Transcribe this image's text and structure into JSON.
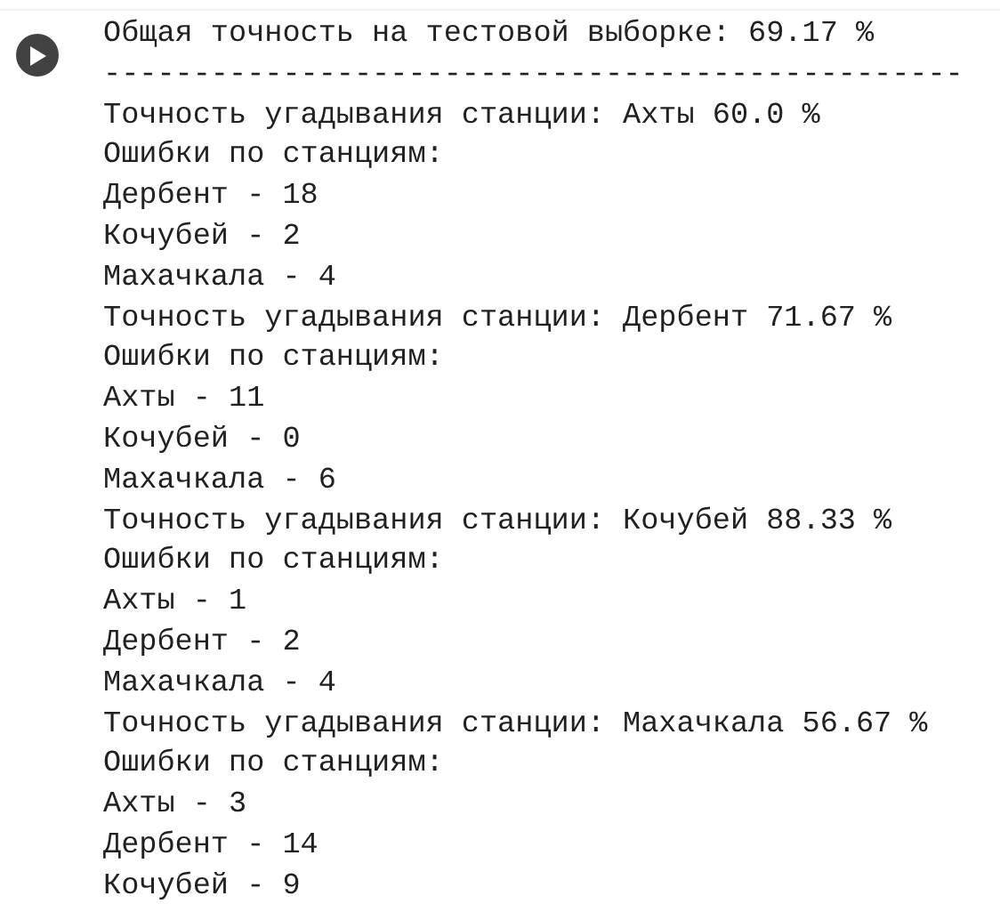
{
  "cell": {
    "output_lines": [
      "Общая точность на тестовой выборке: 69.17 %",
      "------------------------------------------------",
      "Точность угадывания станции: Ахты 60.0 %",
      "Ошибки по станциям:",
      "Дербент - 18",
      "Кочубей - 2",
      "Махачкала - 4",
      "Точность угадывания станции: Дербент 71.67 %",
      "Ошибки по станциям:",
      "Ахты - 11",
      "Кочубей - 0",
      "Махачкала - 6",
      "Точность угадывания станции: Кочубей 88.33 %",
      "Ошибки по станциям:",
      "Ахты - 1",
      "Дербент - 2",
      "Махачкала - 4",
      "Точность угадывания станции: Махачкала 56.67 %",
      "Ошибки по станциям:",
      "Ахты - 3",
      "Дербент - 14",
      "Кочубей - 9"
    ]
  }
}
